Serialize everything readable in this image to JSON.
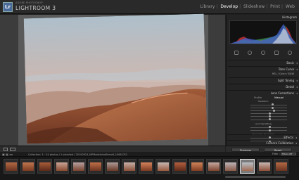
{
  "app": {
    "adobe_label": "ADOBE PHOTOSHOP",
    "title": "LIGHTROOM 3",
    "logo": "Lr"
  },
  "modules": [
    {
      "label": "Library",
      "active": false
    },
    {
      "label": "Develop",
      "active": true
    },
    {
      "label": "Slideshow",
      "active": false
    },
    {
      "label": "Print",
      "active": false
    },
    {
      "label": "Web",
      "active": false
    }
  ],
  "right_panel": {
    "histogram_label": "Histogram",
    "histogram_info": "",
    "sections": [
      "Basic",
      "Tone Curve",
      "Split Toning",
      "Detail",
      "Lens Corrections"
    ],
    "hsl_label": "HSL / Color / B&W",
    "lens_tabs": [
      "Profile",
      "Manual"
    ],
    "subheads": [
      "Transform",
      "Lens Vignetting",
      "Chromatic Aberration"
    ],
    "bottom_sections": [
      "Effects",
      "Camera Calibration"
    ],
    "buttons": {
      "previous": "Previous",
      "reset": "Reset"
    }
  },
  "filmstrip": {
    "breadcrumb": "Collection: 1 · 24 photos / 1 selected / 20100924_MPMadeleineBerndt_1066.CR2",
    "filter_label": "Filter :",
    "filter_value": "Filters Off"
  },
  "colors": {
    "active_module": "#ffffff",
    "selected_thumb": "#dddddd",
    "panel_bg": "#242424"
  }
}
